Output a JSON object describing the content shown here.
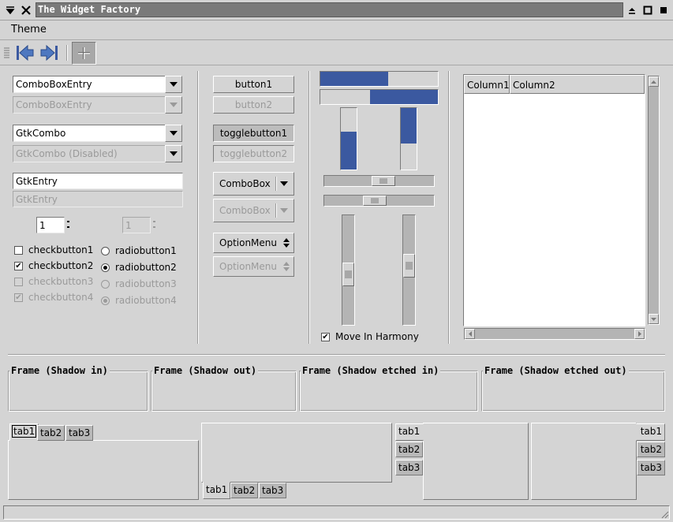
{
  "window": {
    "title": "The Widget Factory"
  },
  "menubar": {
    "theme": "Theme"
  },
  "combos": {
    "comboentry": "ComboBoxEntry",
    "comboentry_disabled": "ComboBoxEntry",
    "gtkcombo": "GtkCombo",
    "gtkcombo_disabled": "GtkCombo (Disabled)",
    "entry": "GtkEntry",
    "entry_disabled": "GtkEntry",
    "spin_value": "1",
    "spin_disabled_value": "1"
  },
  "checks": [
    {
      "label": "checkbutton1",
      "checked": false,
      "disabled": false
    },
    {
      "label": "checkbutton2",
      "checked": true,
      "disabled": false
    },
    {
      "label": "checkbutton3",
      "checked": false,
      "disabled": true
    },
    {
      "label": "checkbutton4",
      "checked": true,
      "disabled": true
    }
  ],
  "radios": [
    {
      "label": "radiobutton1",
      "selected": false,
      "disabled": false
    },
    {
      "label": "radiobutton2",
      "selected": true,
      "disabled": false
    },
    {
      "label": "radiobutton3",
      "selected": false,
      "disabled": true
    },
    {
      "label": "radiobutton4",
      "selected": true,
      "disabled": true
    }
  ],
  "buttons": {
    "button1": "button1",
    "button2": "button2",
    "toggle1": "togglebutton1",
    "toggle2": "togglebutton2",
    "combobox": "ComboBox",
    "combobox_disabled": "ComboBox",
    "optionmenu": "OptionMenu",
    "optionmenu_disabled": "OptionMenu"
  },
  "progress": {
    "h1_fraction": 0.58,
    "h2_fraction": 0.58,
    "v1_fraction": 0.62,
    "v2_fraction": 0.58
  },
  "scales": {
    "h1_value": 0.55,
    "h2_value": 0.45,
    "v1_value": 0.55,
    "v2_value": 0.45
  },
  "harmony": {
    "label": "Move In Harmony",
    "checked": true
  },
  "treeview": {
    "columns": [
      "Column1",
      "Column2"
    ]
  },
  "frames": [
    "Frame (Shadow in)",
    "Frame (Shadow out)",
    "Frame (Shadow etched in)",
    "Frame (Shadow etched out)"
  ],
  "notebooks": {
    "tabs": [
      "tab1",
      "tab2",
      "tab3"
    ]
  },
  "colors": {
    "accent": "#3b59a0",
    "background": "#d4d4d4",
    "titlebar": "#7a7a7a"
  }
}
